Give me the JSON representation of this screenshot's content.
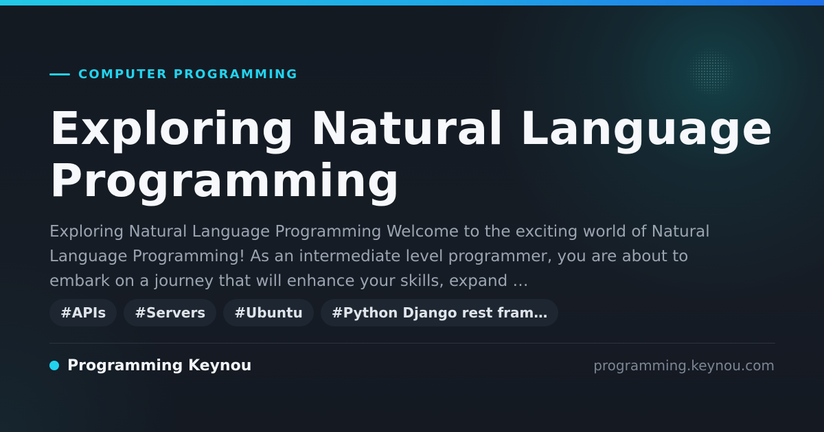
{
  "header": {
    "category": "COMPUTER PROGRAMMING",
    "title": "Exploring Natural Language Programming"
  },
  "description": "Exploring Natural Language Programming Welcome to the exciting world of Natural Language Programming! As an intermediate level programmer, you are about to embark on a journey that will enhance your skills, expand …",
  "tags": [
    {
      "label": "#APIs"
    },
    {
      "label": "#Servers"
    },
    {
      "label": "#Ubuntu"
    },
    {
      "label": "#Python Django rest fram…"
    }
  ],
  "footer": {
    "brand": "Programming Keynou",
    "domain": "programming.keynou.com"
  },
  "colors": {
    "accent": "#22d3ee",
    "background": "#151a22",
    "title": "#f6f8fb",
    "description": "#9ba4b1",
    "tag_background": "#1e2631",
    "muted": "#7d8593"
  }
}
